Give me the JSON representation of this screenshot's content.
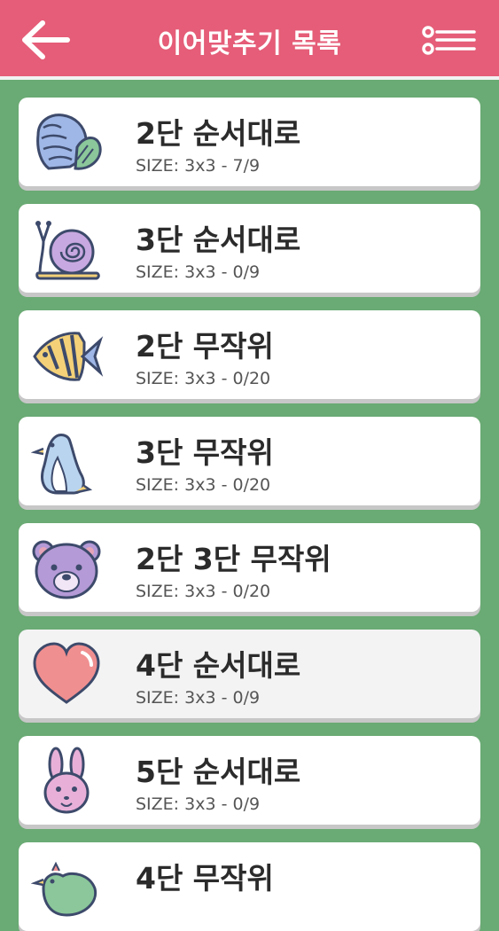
{
  "header": {
    "title": "이어맞추기 목록",
    "back_icon": "arrow-left-icon",
    "menu_icon": "list-menu-icon",
    "bg_color": "#e55d78"
  },
  "background_color": "#6aaa74",
  "items": [
    {
      "name": "2단 순서대로",
      "size": "SIZE: 3x3 - 7/9",
      "icon": "seashell-icon"
    },
    {
      "name": "3단 순서대로",
      "size": "SIZE: 3x3 - 0/9",
      "icon": "snail-icon"
    },
    {
      "name": "2단 무작위",
      "size": "SIZE: 3x3 - 0/20",
      "icon": "fish-icon"
    },
    {
      "name": "3단 무작위",
      "size": "SIZE: 3x3 - 0/20",
      "icon": "penguin-icon"
    },
    {
      "name": "2단 3단 무작위",
      "size": "SIZE: 3x3 - 0/20",
      "icon": "bear-icon"
    },
    {
      "name": "4단 순서대로",
      "size": "SIZE: 3x3 - 0/9",
      "icon": "heart-icon"
    },
    {
      "name": "5단 순서대로",
      "size": "SIZE: 3x3 - 0/9",
      "icon": "rabbit-icon"
    },
    {
      "name": "4단 무작위",
      "size": "",
      "icon": "bird-icon"
    }
  ]
}
